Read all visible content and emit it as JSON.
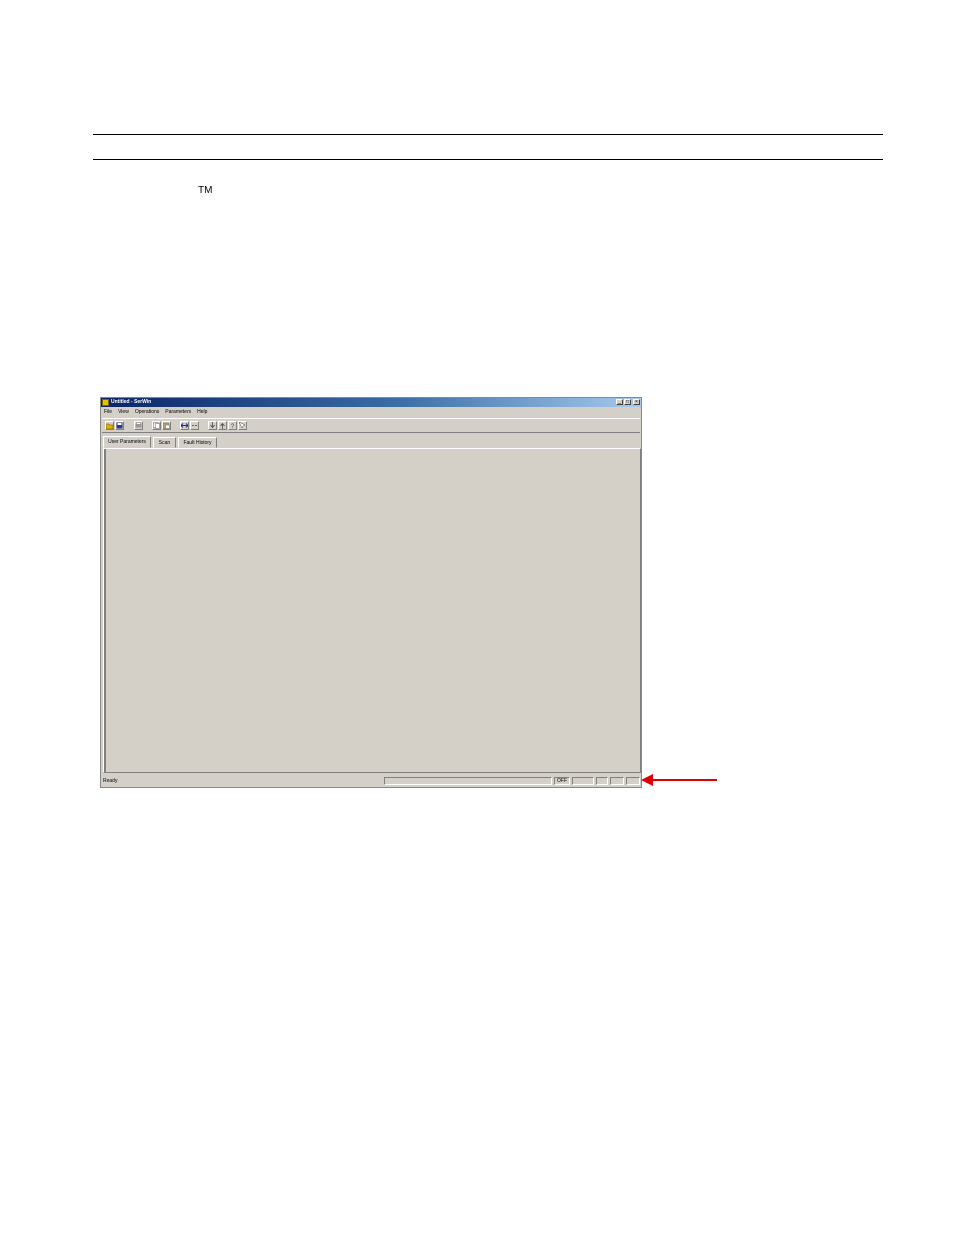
{
  "page": {
    "trademark": "TM"
  },
  "window": {
    "title": "Untitled - SerWin",
    "menu": [
      "File",
      "View",
      "Operations",
      "Parameters",
      "Help"
    ],
    "caption_buttons": [
      "_",
      "□",
      "×"
    ],
    "toolbar_buttons": [
      "open-icon",
      "save-icon",
      "print-icon",
      "copy-icon",
      "paste-icon",
      "connect-icon",
      "disconnect-icon",
      "download-icon",
      "upload-icon",
      "help-icon",
      "context-help-icon"
    ],
    "tabs": [
      "User Parameters",
      "Scan",
      "Fault History"
    ],
    "active_tab": "User Parameters",
    "status": {
      "text": "Ready",
      "indicator": "OFF"
    }
  },
  "annotation": {
    "arrow_color": "#e00000"
  }
}
